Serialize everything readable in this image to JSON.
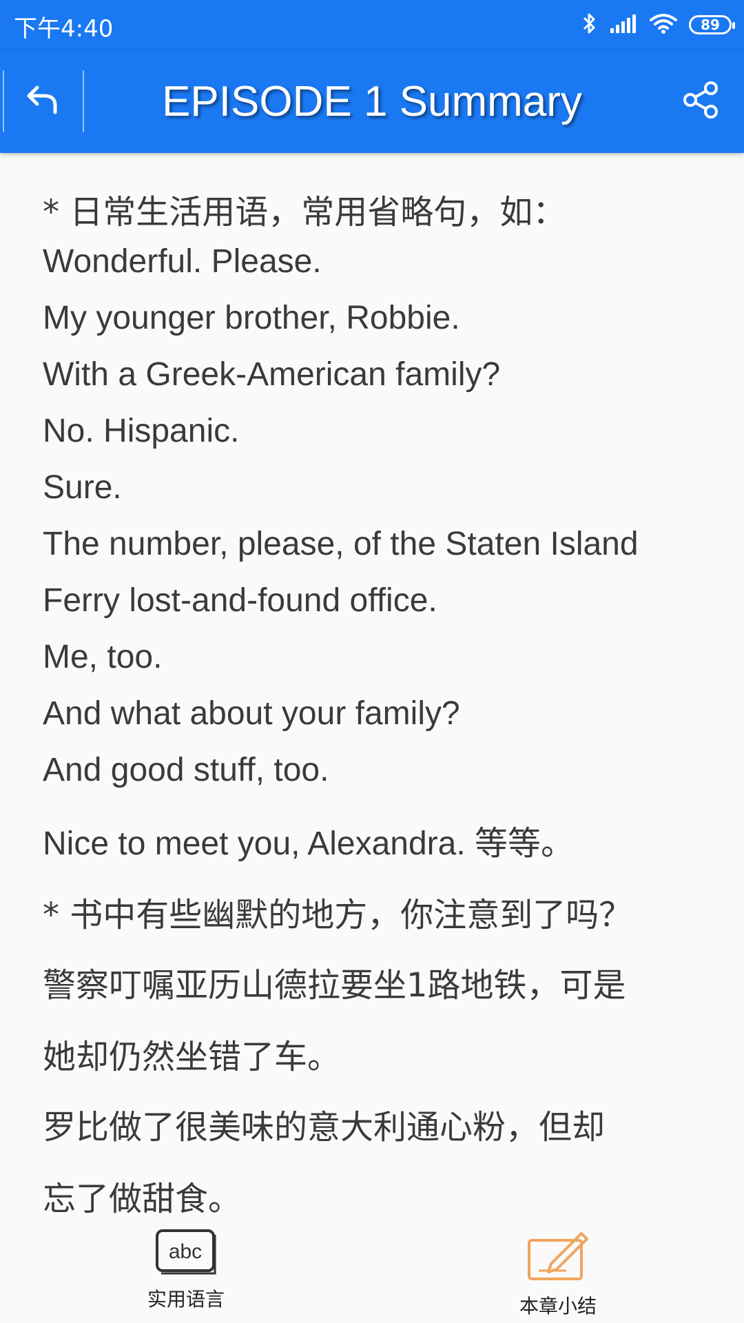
{
  "status_bar": {
    "time": "下午4:40",
    "battery": "89",
    "icons": [
      "bluetooth-icon",
      "signal-icon",
      "wifi-icon",
      "battery-icon"
    ]
  },
  "app_bar": {
    "title": "EPISODE 1 Summary",
    "back_icon": "back-arrow-icon",
    "share_icon": "share-icon",
    "color": "#1a78f2"
  },
  "content": {
    "lines": [
      "*  日常生活用语，常用省略句，如：",
      "Wonderful. Please.",
      "My younger brother, Robbie.",
      "With a Greek-American family?",
      "No. Hispanic.",
      "Sure.",
      "The number, please, of the Staten Island",
      "Ferry lost-and-found office.",
      "Me, too.",
      "And what about your family?",
      "And good stuff, too.",
      "Nice to meet you, Alexandra. 等等。",
      "* 书中有些幽默的地方，你注意到了吗？",
      "警察叮嘱亚历山德拉要坐1路地铁，可是",
      "她却仍然坐错了车。",
      "罗比做了很美味的意大利通心粉，但却",
      "忘了做甜食。"
    ]
  },
  "bottom_bar": {
    "tabs": [
      {
        "label": "实用语言",
        "icon": "abc-keyboard-icon"
      },
      {
        "label": "本章小结",
        "icon": "edit-note-icon"
      }
    ]
  }
}
